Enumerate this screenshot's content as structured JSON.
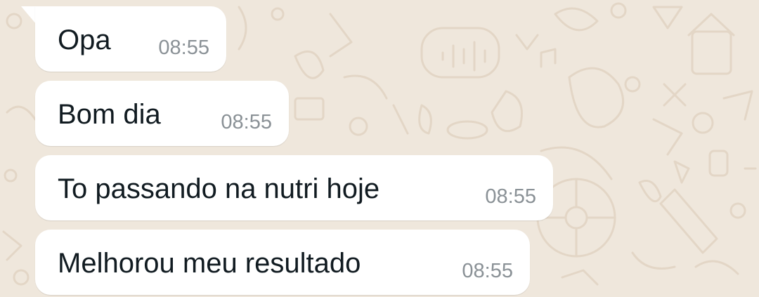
{
  "chat": {
    "messages": [
      {
        "text": "Opa",
        "time": "08:55"
      },
      {
        "text": "Bom dia",
        "time": "08:55"
      },
      {
        "text": "To passando na nutri hoje",
        "time": "08:55"
      },
      {
        "text": "Melhorou meu resultado",
        "time": "08:55"
      }
    ]
  },
  "colors": {
    "wallpaper": "#efe7dc",
    "bubble": "#ffffff",
    "text": "#111b21",
    "timestamp": "#8a9196"
  }
}
